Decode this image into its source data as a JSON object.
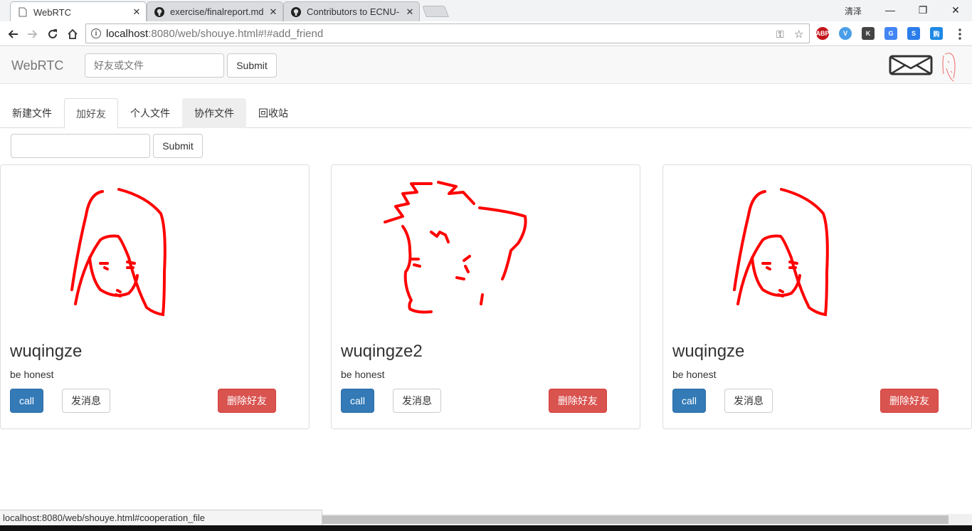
{
  "browser": {
    "tabs": [
      {
        "title": "WebRTC",
        "active": true
      },
      {
        "title": "exercise/finalreport.md",
        "active": false
      },
      {
        "title": "Contributors to ECNU-",
        "active": false
      }
    ],
    "user_name": "清泽",
    "url_host": "localhost",
    "url_rest": ":8080/web/shouye.html#!#add_friend",
    "extensions": [
      "ABP",
      "V",
      "K",
      "G",
      "S",
      "购"
    ]
  },
  "navbar": {
    "brand": "WebRTC",
    "search_placeholder": "好友或文件",
    "submit_label": "Submit"
  },
  "page_tabs": [
    "新建文件",
    "加好友",
    "个人文件",
    "协作文件",
    "回收站"
  ],
  "add_friend": {
    "input_value": "",
    "submit_label": "Submit"
  },
  "friends": [
    {
      "name": "wuqingze",
      "motto": "be honest",
      "call_label": "call",
      "message_label": "发消息",
      "delete_label": "删除好友",
      "avatar": "girl-sketch"
    },
    {
      "name": "wuqingze2",
      "motto": "be honest",
      "call_label": "call",
      "message_label": "发消息",
      "delete_label": "删除好友",
      "avatar": "boy-sketch"
    },
    {
      "name": "wuqingze",
      "motto": "be honest",
      "call_label": "call",
      "message_label": "发消息",
      "delete_label": "删除好友",
      "avatar": "girl-sketch"
    }
  ],
  "status_bar": "localhost:8080/web/shouye.html#cooperation_file",
  "colors": {
    "primary": "#337ab7",
    "danger": "#d9534f",
    "sketch": "#ff0000"
  }
}
